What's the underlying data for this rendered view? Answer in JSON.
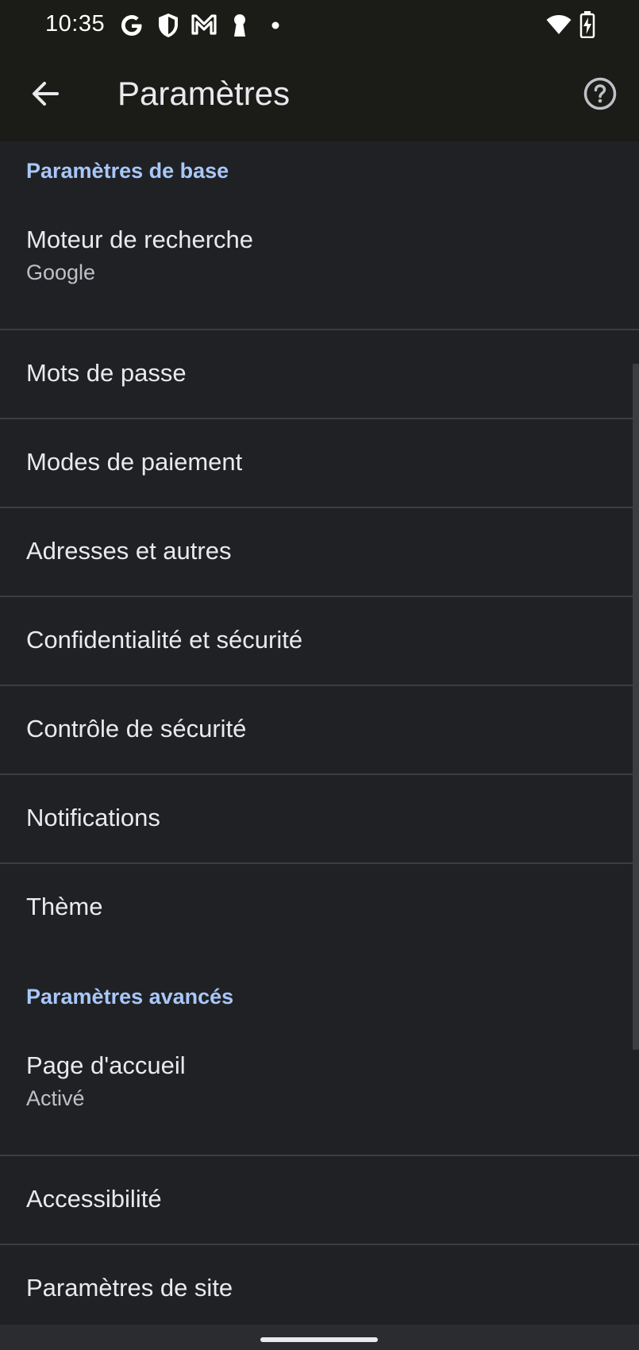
{
  "status_bar": {
    "time": "10:35",
    "notification_icons": [
      "google-icon",
      "shield-icon",
      "gmail-icon",
      "keyhole-icon",
      "dot-icon"
    ],
    "system_icons": [
      "wifi-icon",
      "battery-charging-icon"
    ]
  },
  "app_bar": {
    "title": "Paramètres",
    "back_icon": "arrow-back-icon",
    "help_icon": "help-icon"
  },
  "sections": [
    {
      "header": "Paramètres de base",
      "items": [
        {
          "title": "Moteur de recherche",
          "subtitle": "Google"
        },
        {
          "title": "Mots de passe"
        },
        {
          "title": "Modes de paiement"
        },
        {
          "title": "Adresses et autres"
        },
        {
          "title": "Confidentialité et sécurité"
        },
        {
          "title": "Contrôle de sécurité"
        },
        {
          "title": "Notifications"
        },
        {
          "title": "Thème"
        }
      ]
    },
    {
      "header": "Paramètres avancés",
      "items": [
        {
          "title": "Page d'accueil",
          "subtitle": "Activé"
        },
        {
          "title": "Accessibilité"
        },
        {
          "title": "Paramètres de site"
        }
      ]
    }
  ],
  "colors": {
    "background": "#202124",
    "app_bar": "#1b1b17",
    "accent": "#a8c7fa",
    "text_primary": "#e8eaed",
    "text_secondary": "#bdc1c6",
    "divider": "#3c3d40"
  }
}
